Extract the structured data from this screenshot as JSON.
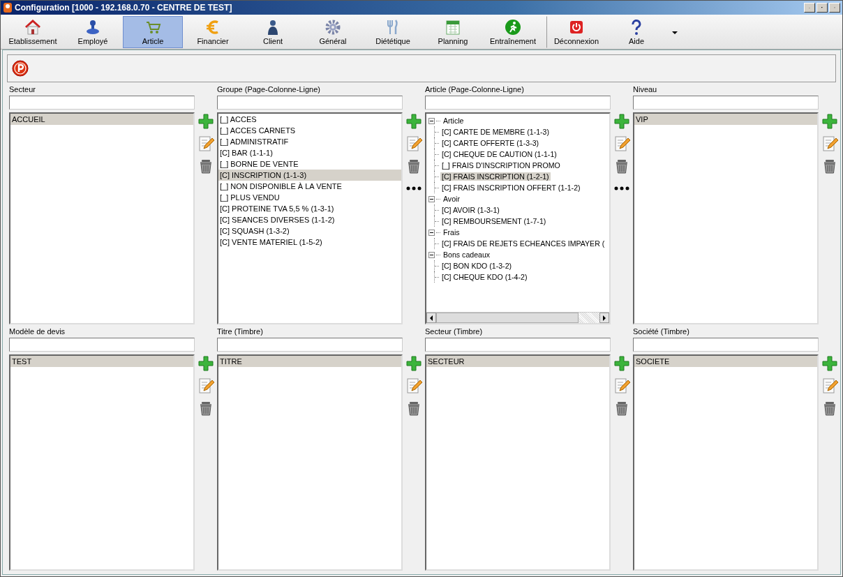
{
  "window": {
    "title": "Configuration [1000 - 192.168.0.70 - CENTRE DE TEST]"
  },
  "toolbar": [
    {
      "label": "Etablissement",
      "selected": false,
      "separator_before": false
    },
    {
      "label": "Employé",
      "selected": false,
      "separator_before": false
    },
    {
      "label": "Article",
      "selected": true,
      "separator_before": false
    },
    {
      "label": "Financier",
      "selected": false,
      "separator_before": false
    },
    {
      "label": "Client",
      "selected": false,
      "separator_before": false
    },
    {
      "label": "Général",
      "selected": false,
      "separator_before": false
    },
    {
      "label": "Diététique",
      "selected": false,
      "separator_before": false
    },
    {
      "label": "Planning",
      "selected": false,
      "separator_before": false
    },
    {
      "label": "Entraînement",
      "selected": false,
      "separator_before": false
    },
    {
      "label": "Déconnexion",
      "selected": false,
      "separator_before": true
    },
    {
      "label": "Aide",
      "selected": false,
      "separator_before": false
    }
  ],
  "rows": [
    [
      {
        "label": "Secteur",
        "kind": "list",
        "more": false,
        "items": [
          {
            "text": "ACCUEIL",
            "selected": true
          }
        ]
      },
      {
        "label": "Groupe (Page-Colonne-Ligne)",
        "kind": "list",
        "more": true,
        "items": [
          {
            "text": "[_] ACCES",
            "selected": false
          },
          {
            "text": "[_] ACCES CARNETS",
            "selected": false
          },
          {
            "text": "[_] ADMINISTRATIF",
            "selected": false
          },
          {
            "text": "[C] BAR (1-1-1)",
            "selected": false
          },
          {
            "text": "[_] BORNE DE VENTE",
            "selected": false
          },
          {
            "text": "[C] INSCRIPTION (1-1-3)",
            "selected": true
          },
          {
            "text": "[_] NON DISPONIBLE À LA VENTE",
            "selected": false
          },
          {
            "text": "[_] PLUS VENDU",
            "selected": false
          },
          {
            "text": "[C] PROTEINE TVA 5,5 % (1-3-1)",
            "selected": false
          },
          {
            "text": "[C] SEANCES DIVERSES (1-1-2)",
            "selected": false
          },
          {
            "text": "[C] SQUASH (1-3-2)",
            "selected": false
          },
          {
            "text": "[C] VENTE MATERIEL (1-5-2)",
            "selected": false
          }
        ]
      },
      {
        "label": "Article (Page-Colonne-Ligne)",
        "kind": "tree",
        "more": true,
        "items": [
          {
            "text": "Article",
            "selected": false,
            "expanded": true,
            "children": [
              {
                "text": "[C] CARTE DE MEMBRE (1-1-3)",
                "selected": false
              },
              {
                "text": "[C] CARTE OFFERTE (1-3-3)",
                "selected": false
              },
              {
                "text": "[C] CHEQUE DE CAUTION (1-1-1)",
                "selected": false
              },
              {
                "text": "[_] FRAIS D'INSCRIPTION PROMO",
                "selected": false
              },
              {
                "text": "[C] FRAIS INSCRIPTION (1-2-1)",
                "selected": true
              },
              {
                "text": "[C] FRAIS INSCRIPTION OFFERT (1-1-2)",
                "selected": false
              }
            ]
          },
          {
            "text": "Avoir",
            "selected": false,
            "expanded": true,
            "children": [
              {
                "text": "[C] AVOIR (1-3-1)",
                "selected": false
              },
              {
                "text": "[C] REMBOURSEMENT (1-7-1)",
                "selected": false
              }
            ]
          },
          {
            "text": "Frais",
            "selected": false,
            "expanded": true,
            "children": [
              {
                "text": "[C] FRAIS DE REJETS ECHEANCES IMPAYER (",
                "selected": false
              }
            ]
          },
          {
            "text": "Bons cadeaux",
            "selected": false,
            "expanded": true,
            "children": [
              {
                "text": "[C] BON KDO (1-3-2)",
                "selected": false
              },
              {
                "text": "[C] CHEQUE KDO (1-4-2)",
                "selected": false
              }
            ]
          }
        ]
      },
      {
        "label": "Niveau",
        "kind": "list",
        "more": false,
        "items": [
          {
            "text": "VIP",
            "selected": true
          }
        ]
      }
    ],
    [
      {
        "label": "Modèle de devis",
        "kind": "list",
        "more": false,
        "items": [
          {
            "text": "TEST",
            "selected": true
          }
        ]
      },
      {
        "label": "Titre (Timbre)",
        "kind": "list",
        "more": false,
        "items": [
          {
            "text": "TITRE",
            "selected": true
          }
        ]
      },
      {
        "label": "Secteur (Timbre)",
        "kind": "list",
        "more": false,
        "items": [
          {
            "text": "SECTEUR",
            "selected": true
          }
        ]
      },
      {
        "label": "Société (Timbre)",
        "kind": "list",
        "more": false,
        "items": [
          {
            "text": "SOCIETE",
            "selected": true
          }
        ]
      }
    ]
  ]
}
